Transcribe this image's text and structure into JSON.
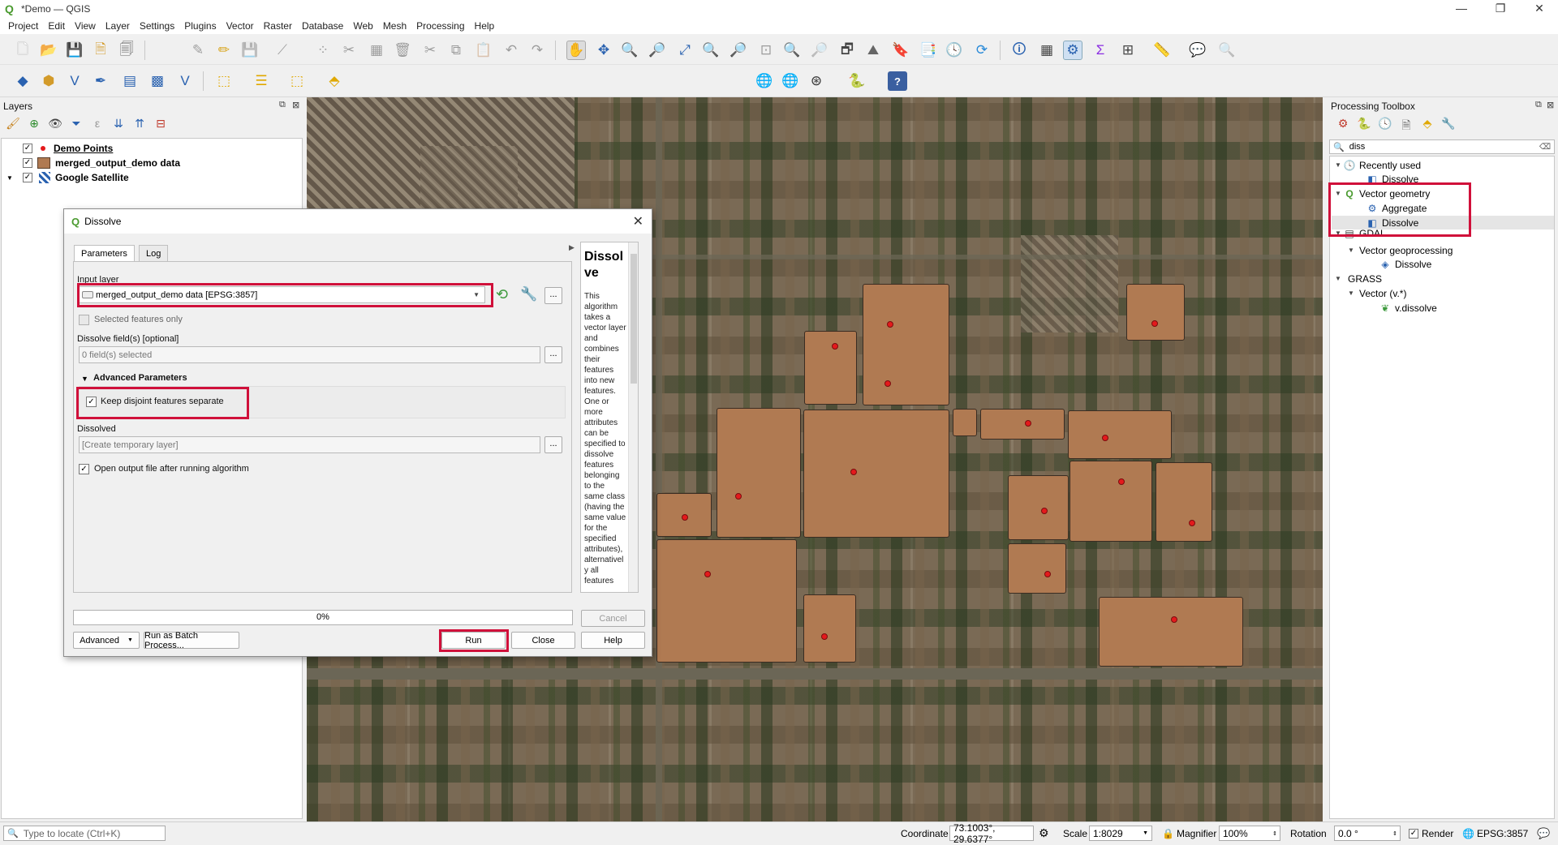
{
  "window": {
    "title": "*Demo — QGIS",
    "minimize": "—",
    "restore": "❐",
    "close": "✕"
  },
  "menu": [
    "Project",
    "Edit",
    "View",
    "Layer",
    "Settings",
    "Plugins",
    "Vector",
    "Raster",
    "Database",
    "Web",
    "Mesh",
    "Processing",
    "Help"
  ],
  "layers_panel": {
    "title": "Layers",
    "layers": [
      {
        "name": "Demo Points",
        "checked": true,
        "symbol": "red-point-icon"
      },
      {
        "name": "merged_output_demo data",
        "checked": true,
        "symbol": "brown-polygon-icon"
      },
      {
        "name": "Google Satellite",
        "checked": true,
        "symbol": "raster-tile-icon"
      }
    ]
  },
  "dialog": {
    "title": "Dissolve",
    "tabs": {
      "parameters": "Parameters",
      "log": "Log"
    },
    "input_layer_label": "Input layer",
    "input_layer_value": "merged_output_demo data [EPSG:3857]",
    "selected_only_label": "Selected features only",
    "dissolve_fields_label": "Dissolve field(s) [optional]",
    "dissolve_fields_value": "0 field(s) selected",
    "advanced_params_label": "Advanced Parameters",
    "keep_disjoint_label": "Keep disjoint features separate",
    "keep_disjoint_checked": true,
    "dissolved_label": "Dissolved",
    "dissolved_placeholder": "[Create temporary layer]",
    "open_output_label": "Open output file after running algorithm",
    "open_output_checked": true,
    "browse_label": "...",
    "help_title": "Dissolve",
    "help_text": "This algorithm takes a vector layer and combines their features into new features. One or more attributes can be specified to dissolve features belonging to the same class (having the same value for the specified attributes), alternatively all features",
    "progress": "0%",
    "buttons": {
      "cancel": "Cancel",
      "advanced": "Advanced",
      "batch": "Run as Batch Process...",
      "run": "Run",
      "close": "Close",
      "help": "Help"
    }
  },
  "toolbox": {
    "title": "Processing Toolbox",
    "search_value": "diss",
    "tree": [
      {
        "label": "Recently used",
        "level": 0,
        "expanded": true,
        "icon": "clock-icon"
      },
      {
        "label": "Dissolve",
        "level": 1,
        "icon": "dissolve-icon"
      },
      {
        "label": "Vector geometry",
        "level": 0,
        "expanded": true,
        "icon": "qgis-icon"
      },
      {
        "label": "Aggregate",
        "level": 1,
        "icon": "gear-icon"
      },
      {
        "label": "Dissolve",
        "level": 1,
        "icon": "dissolve-icon"
      },
      {
        "label": "GDAL",
        "level": 0,
        "expanded": true,
        "icon": "gdal-icon"
      },
      {
        "label": "Vector geoprocessing",
        "level": 1,
        "expanded": true,
        "icon": ""
      },
      {
        "label": "Dissolve",
        "level": 2,
        "icon": "gdal-icon"
      },
      {
        "label": "GRASS",
        "level": 0,
        "expanded": true,
        "icon": ""
      },
      {
        "label": "Vector (v.*)",
        "level": 1,
        "expanded": true,
        "icon": ""
      },
      {
        "label": "v.dissolve",
        "level": 2,
        "icon": "grass-icon"
      }
    ]
  },
  "statusbar": {
    "locate_placeholder": "Type to locate (Ctrl+K)",
    "coordinate_label": "Coordinate",
    "coordinate_value": "73.1003°, 29.6377°",
    "scale_label": "Scale",
    "scale_value": "1:8029",
    "magnifier_label": "Magnifier",
    "magnifier_value": "100%",
    "rotation_label": "Rotation",
    "rotation_value": "0.0 °",
    "render_label": "Render",
    "crs": "EPSG:3857"
  },
  "colors": {
    "highlight": "#d0103a",
    "polygon_fill": "#b07a52",
    "point": "#e41a1c",
    "qgis_green": "#4a9a2f"
  }
}
